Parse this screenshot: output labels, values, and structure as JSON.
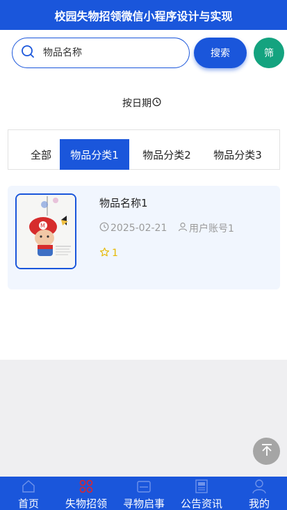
{
  "header": {
    "title": "校园失物招领微信小程序设计与实现"
  },
  "search": {
    "placeholder": "物品名称",
    "button_label": "搜索",
    "filter_label": "筛"
  },
  "sort": {
    "label": "按日期"
  },
  "tabs": [
    {
      "label": "全部",
      "active": false
    },
    {
      "label": "物品分类1",
      "active": true
    },
    {
      "label": "物品分类2",
      "active": false
    },
    {
      "label": "物品分类3",
      "active": false
    }
  ],
  "items": [
    {
      "name": "物品名称1",
      "date": "2025-02-21",
      "account": "用户账号1",
      "likes": "1"
    }
  ],
  "nav": [
    {
      "label": "首页",
      "icon": "home-icon"
    },
    {
      "label": "失物招领",
      "icon": "grid-icon"
    },
    {
      "label": "寻物启事",
      "icon": "notice-board-icon"
    },
    {
      "label": "公告资讯",
      "icon": "news-icon"
    },
    {
      "label": "我的",
      "icon": "user-icon"
    }
  ],
  "colors": {
    "primary": "#1a56db",
    "filter": "#14a37f",
    "card_bg": "#f1f6fe",
    "star": "#e6b800",
    "nav_active_icon": "#e0242b"
  }
}
